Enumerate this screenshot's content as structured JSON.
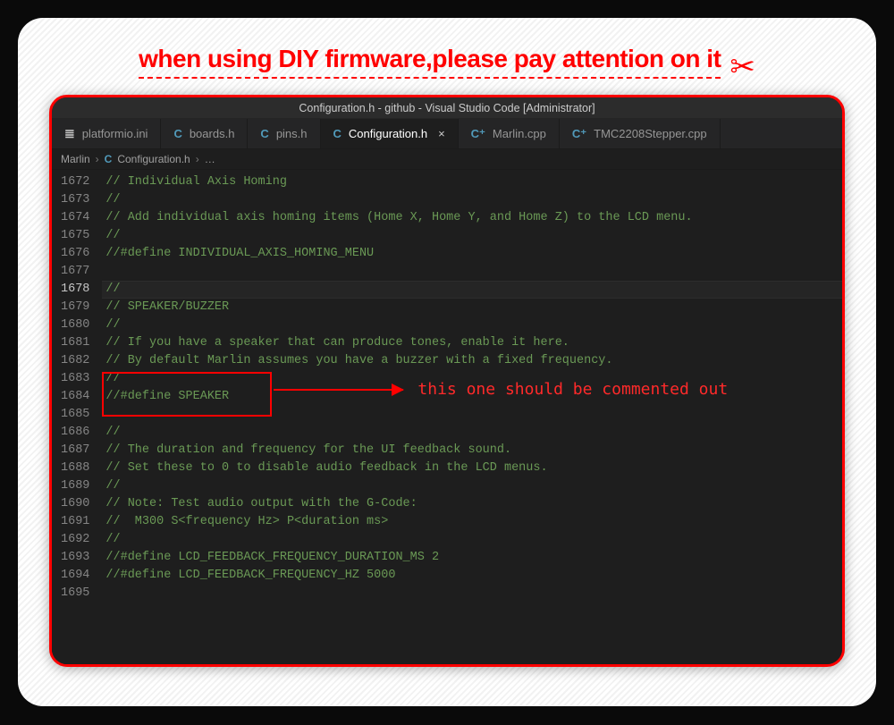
{
  "headline": "when using DIY firmware,please pay attention on it",
  "titlebar": "Configuration.h - github - Visual Studio Code [Administrator]",
  "tabs": [
    {
      "icon": "≣",
      "iconClass": "icon-ini",
      "label": "platformio.ini"
    },
    {
      "icon": "C",
      "iconClass": "icon-c",
      "label": "boards.h"
    },
    {
      "icon": "C",
      "iconClass": "icon-c",
      "label": "pins.h"
    },
    {
      "icon": "C",
      "iconClass": "icon-c",
      "label": "Configuration.h",
      "active": true,
      "close": "×"
    },
    {
      "icon": "C⁺",
      "iconClass": "icon-cpp",
      "label": "Marlin.cpp"
    },
    {
      "icon": "C⁺",
      "iconClass": "icon-cpp",
      "label": "TMC2208Stepper.cpp"
    }
  ],
  "breadcrumb": {
    "root": "Marlin",
    "icon": "C",
    "file": "Configuration.h",
    "more": "…"
  },
  "code_start_line": 1672,
  "current_line": 1678,
  "highlight_line": 1684,
  "code_lines": [
    "// Individual Axis Homing",
    "//",
    "// Add individual axis homing items (Home X, Home Y, and Home Z) to the LCD menu.",
    "//",
    "//#define INDIVIDUAL_AXIS_HOMING_MENU",
    "",
    "//",
    "// SPEAKER/BUZZER",
    "//",
    "// If you have a speaker that can produce tones, enable it here.",
    "// By default Marlin assumes you have a buzzer with a fixed frequency.",
    "//",
    "//#define SPEAKER",
    "",
    "//",
    "// The duration and frequency for the UI feedback sound.",
    "// Set these to 0 to disable audio feedback in the LCD menus.",
    "//",
    "// Note: Test audio output with the G-Code:",
    "//  M300 S<frequency Hz> P<duration ms>",
    "//",
    "//#define LCD_FEEDBACK_FREQUENCY_DURATION_MS 2",
    "//#define LCD_FEEDBACK_FREQUENCY_HZ 5000",
    ""
  ],
  "annotation": "this one should be commented out"
}
